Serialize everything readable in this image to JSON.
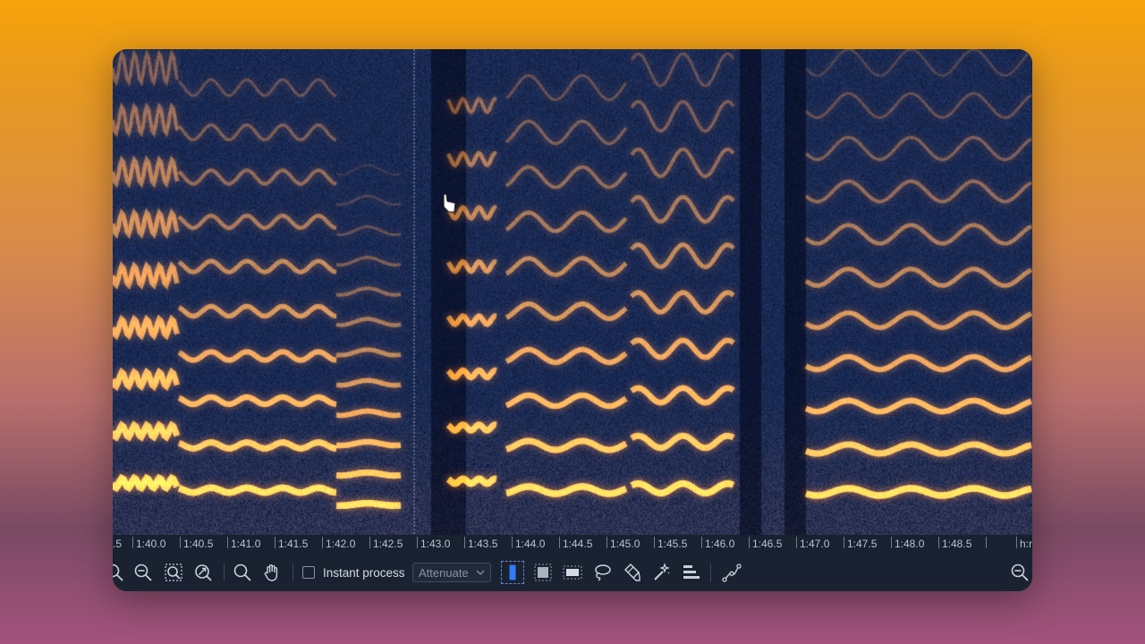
{
  "ruler": {
    "labels": [
      "1:40.0",
      "1:40.5",
      "1:41.0",
      "1:41.5",
      "1:42.0",
      "1:42.5",
      "1:43.0",
      "1:43.5",
      "1:44.0",
      "1:44.5",
      "1:45.0",
      "1:45.5",
      "1:46.0",
      "1:46.5",
      "1:47.0",
      "1:47.5",
      "1:48.0",
      "1:48.5"
    ],
    "left_partial": ".5",
    "right_partial": "h:r"
  },
  "toolbar": {
    "instant_process_label": "Instant process",
    "instant_process_checked": false,
    "mode_select_value": "Attenuate"
  },
  "icons": {
    "zoom_out_left": "zoom-out-icon",
    "zoom_out": "zoom-out-icon",
    "zoom_selection": "zoom-selection-icon",
    "zoom_fit": "zoom-fit-icon",
    "magnify": "magnify-icon",
    "hand": "hand-tool-icon",
    "time_selection": "time-selection-icon",
    "freq_selection": "frequency-selection-icon",
    "rect_selection": "rectangle-selection-icon",
    "lasso": "lasso-icon",
    "brush": "brush-icon",
    "magic_wand": "magic-wand-icon",
    "harmonic": "harmonic-selection-icon",
    "envelope": "envelope-icon",
    "zoom_right": "zoom-icon"
  },
  "colors": {
    "spectrogram_low": "#0b1a3a",
    "spectrogram_high": "#ffb830",
    "accent_blue": "#2f7cf6"
  }
}
